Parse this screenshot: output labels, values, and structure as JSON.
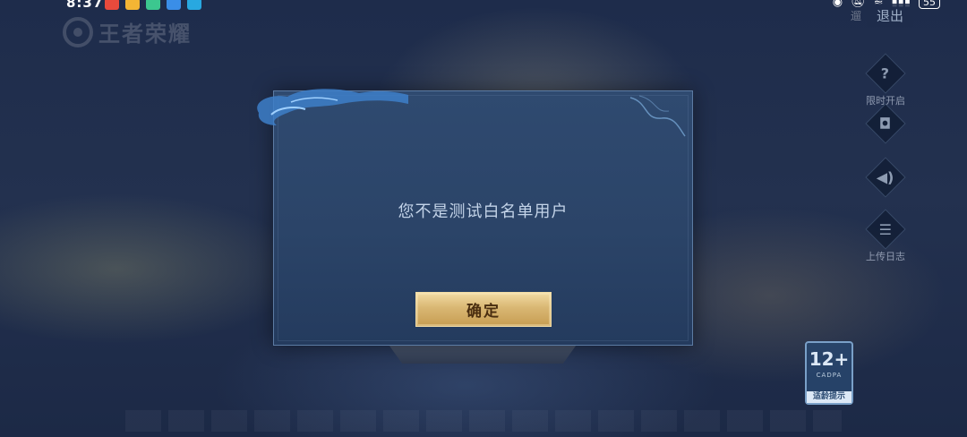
{
  "status_bar": {
    "time": "8:37",
    "more_indicator": "···",
    "battery": "55",
    "app_icon_colors": [
      "#e84a3c",
      "#f3b534",
      "#3cc78f",
      "#3a8ee8",
      "#28a8e0"
    ],
    "system_icons": [
      "eye-icon",
      "mute-bell-icon",
      "wifi-icon",
      "signal-icon"
    ]
  },
  "game_logo": {
    "text": "王者荣耀"
  },
  "exit": {
    "hint": "遛",
    "label": "退出"
  },
  "side_tools": [
    {
      "icon": "question-icon",
      "glyph": "?",
      "label": "限时开启"
    },
    {
      "icon": "gamepad-icon",
      "glyph": "◘",
      "label": ""
    },
    {
      "icon": "speaker-icon",
      "glyph": "◀)",
      "label": ""
    },
    {
      "icon": "clipboard-icon",
      "glyph": "☰",
      "label": "上传日志"
    }
  ],
  "dialog": {
    "message": "您不是测试白名单用户",
    "confirm_label": "确定"
  },
  "age_rating": {
    "age": "12+",
    "org": "CADPA",
    "hint": "适龄提示"
  },
  "colors": {
    "dialog_border": "#5c7ba3",
    "button_gold": "#d9b773",
    "message_text": "#c3d3e8"
  }
}
